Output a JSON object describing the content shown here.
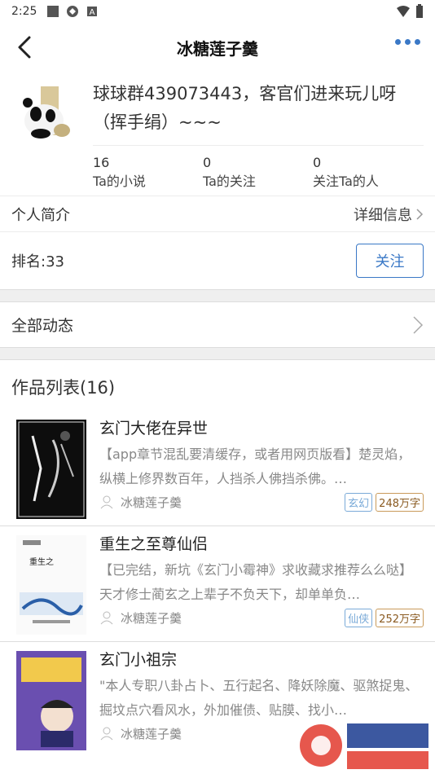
{
  "status": {
    "time": "2:25"
  },
  "nav": {
    "title": "冰糖莲子羹"
  },
  "profile": {
    "bio_line1": "球球群439073443，客官们进来玩儿呀",
    "bio_line2": "（挥手绢）~~~",
    "stats": [
      {
        "num": "16",
        "label": "Ta的小说"
      },
      {
        "num": "0",
        "label": "Ta的关注"
      },
      {
        "num": "0",
        "label": "关注Ta的人"
      }
    ]
  },
  "intro": {
    "label": "个人简介",
    "detail": "详细信息"
  },
  "rank": {
    "label": "排名:33",
    "follow": "关注"
  },
  "dynamics": {
    "label": "全部动态"
  },
  "works": {
    "title": "作品列表(16)",
    "books": [
      {
        "title": "玄门大佬在异世",
        "desc": "【app章节混乱要清缓存，或者用网页版看】楚灵焰，纵横上修界数百年，人挡杀人佛挡杀佛。…",
        "author": "冰糖莲子羹",
        "tag": "玄幻",
        "count": "248万字"
      },
      {
        "title": "重生之至尊仙侣",
        "desc": "【已完结，新坑《玄门小霉神》求收藏求推荐么么哒】 天才修士蔺玄之上辈子不负天下，却单单负…",
        "author": "冰糖莲子羹",
        "tag": "仙侠",
        "count": "252万字"
      },
      {
        "title": "玄门小祖宗",
        "desc": "\"本人专职八卦占卜、五行起名、降妖除魔、驱煞捉鬼、掘坟点穴看风水，外加催债、贴膜、找小…",
        "author": "冰糖莲子羹",
        "tag": "",
        "count": ""
      }
    ]
  },
  "colors": {
    "accent": "#3a78c6",
    "tag": "#7aaad8",
    "count": "#8a5a20"
  }
}
